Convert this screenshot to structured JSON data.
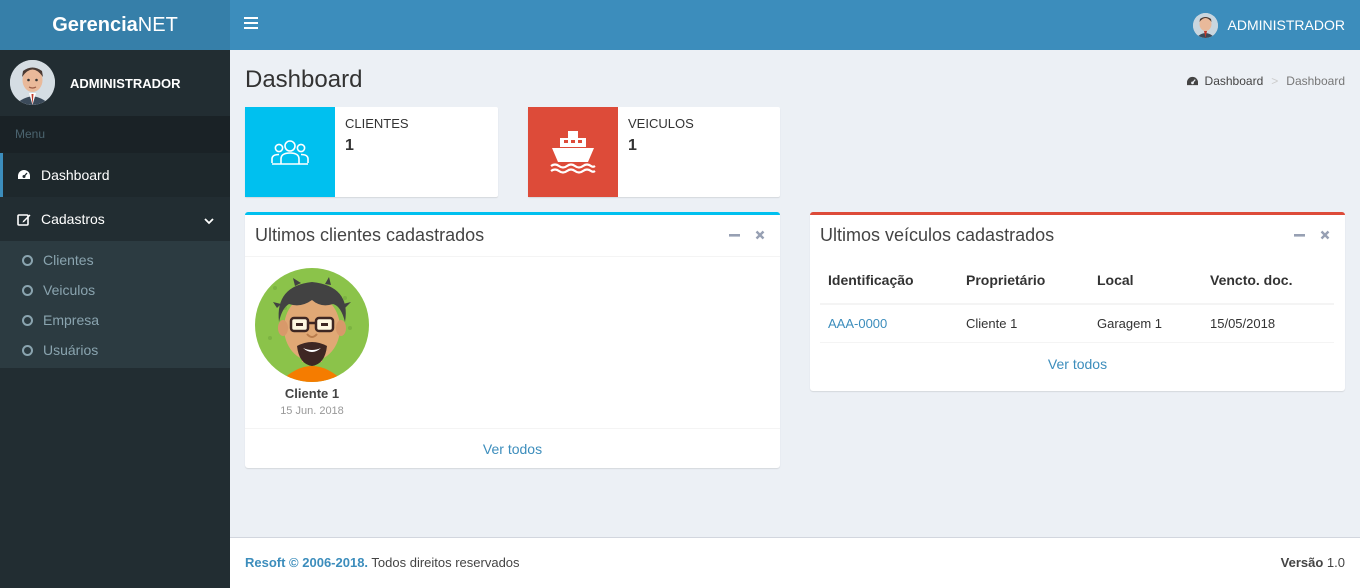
{
  "app": {
    "logo_bold": "Gerencia",
    "logo_rest": "NET"
  },
  "navbar": {
    "user_name": "ADMINISTRADOR"
  },
  "sidebar": {
    "user_name": "ADMINISTRADOR",
    "header": "Menu",
    "items": [
      {
        "label": "Dashboard",
        "icon": "dashboard-icon"
      },
      {
        "label": "Cadastros",
        "icon": "edit-icon"
      }
    ],
    "subitems": [
      {
        "label": "Clientes"
      },
      {
        "label": "Veiculos"
      },
      {
        "label": "Empresa"
      },
      {
        "label": "Usuários"
      }
    ]
  },
  "page": {
    "title": "Dashboard"
  },
  "breadcrumb": {
    "home": "Dashboard",
    "current": "Dashboard"
  },
  "info_boxes": [
    {
      "label": "CLIENTES",
      "value": "1",
      "color": "#00c0ef",
      "icon": "users-icon"
    },
    {
      "label": "VEICULOS",
      "value": "1",
      "color": "#dd4b39",
      "icon": "ship-icon"
    }
  ],
  "clients_box": {
    "title": "Ultimos clientes cadastrados",
    "border_color": "#00c0ef",
    "client": {
      "name": "Cliente 1",
      "date": "15 Jun. 2018"
    },
    "footer_link": "Ver todos"
  },
  "vehicles_box": {
    "title": "Ultimos veículos cadastrados",
    "border_color": "#dd4b39",
    "columns": [
      "Identificação",
      "Proprietário",
      "Local",
      "Vencto. doc."
    ],
    "rows": [
      {
        "id": "AAA-0000",
        "owner": "Cliente 1",
        "local": "Garagem 1",
        "date": "15/05/2018"
      }
    ],
    "footer_link": "Ver todos"
  },
  "footer": {
    "copyright": "Resoft © 2006-2018.",
    "rights": " Todos direitos reservados",
    "version_label": "Versão",
    "version_value": " 1.0"
  }
}
